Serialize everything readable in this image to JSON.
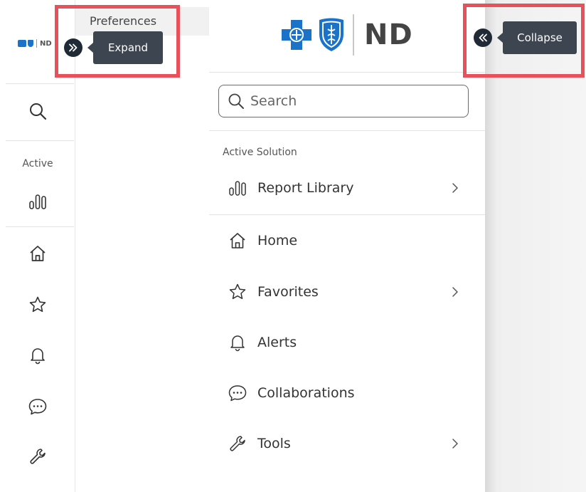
{
  "brand": {
    "name": "ND",
    "mini_name": "ND",
    "colors": {
      "primary_blue": "#1a73c9",
      "text_dark": "#444444"
    }
  },
  "left_nav": {
    "active_label": "Active",
    "icons": [
      "search-icon",
      "bar-chart-icon",
      "home-icon",
      "star-icon",
      "bell-icon",
      "chat-icon",
      "wrench-icon"
    ]
  },
  "tooltips": {
    "expand": "Expand",
    "collapse": "Collapse"
  },
  "preferences_label": "Preferences",
  "search": {
    "placeholder": "Search"
  },
  "menu": {
    "section_label": "Active Solution",
    "items": [
      {
        "label": "Report Library",
        "icon": "bar-chart-icon",
        "has_submenu": true
      },
      {
        "label": "Home",
        "icon": "home-icon",
        "has_submenu": false
      },
      {
        "label": "Favorites",
        "icon": "star-icon",
        "has_submenu": true
      },
      {
        "label": "Alerts",
        "icon": "bell-icon",
        "has_submenu": false
      },
      {
        "label": "Collaborations",
        "icon": "chat-icon",
        "has_submenu": false
      },
      {
        "label": "Tools",
        "icon": "wrench-icon",
        "has_submenu": true
      }
    ]
  },
  "highlight_color": "#e8515b"
}
